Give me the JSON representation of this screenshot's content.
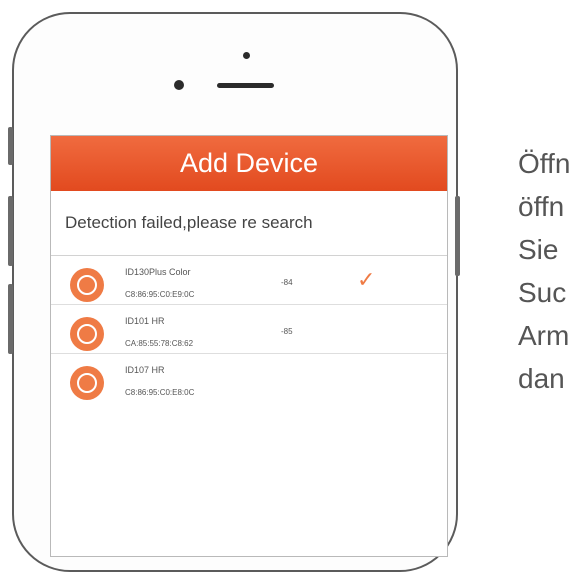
{
  "app": {
    "title": "Add Device",
    "status_message": "Detection failed,please re search"
  },
  "devices": [
    {
      "name": "ID130Plus Color",
      "mac": "C8:86:95:C0:E9:0C",
      "signal": "-84",
      "selected": true
    },
    {
      "name": "ID101 HR",
      "mac": "CA:85:55:78:C8:62",
      "signal": "-85",
      "selected": false
    },
    {
      "name": "ID107 HR",
      "mac": "C8:86:95:C0:E8:0C",
      "signal": "",
      "selected": false
    }
  ],
  "side_text": {
    "lines": [
      "Öffn",
      "öffn",
      "Sie",
      "Suc",
      "Arm",
      "dan"
    ]
  },
  "icons": {
    "device_logo": "device-logo-icon",
    "selected": "checkmark-icon"
  },
  "colors": {
    "accent": "#ef7b45",
    "header": "#e85a2c"
  }
}
